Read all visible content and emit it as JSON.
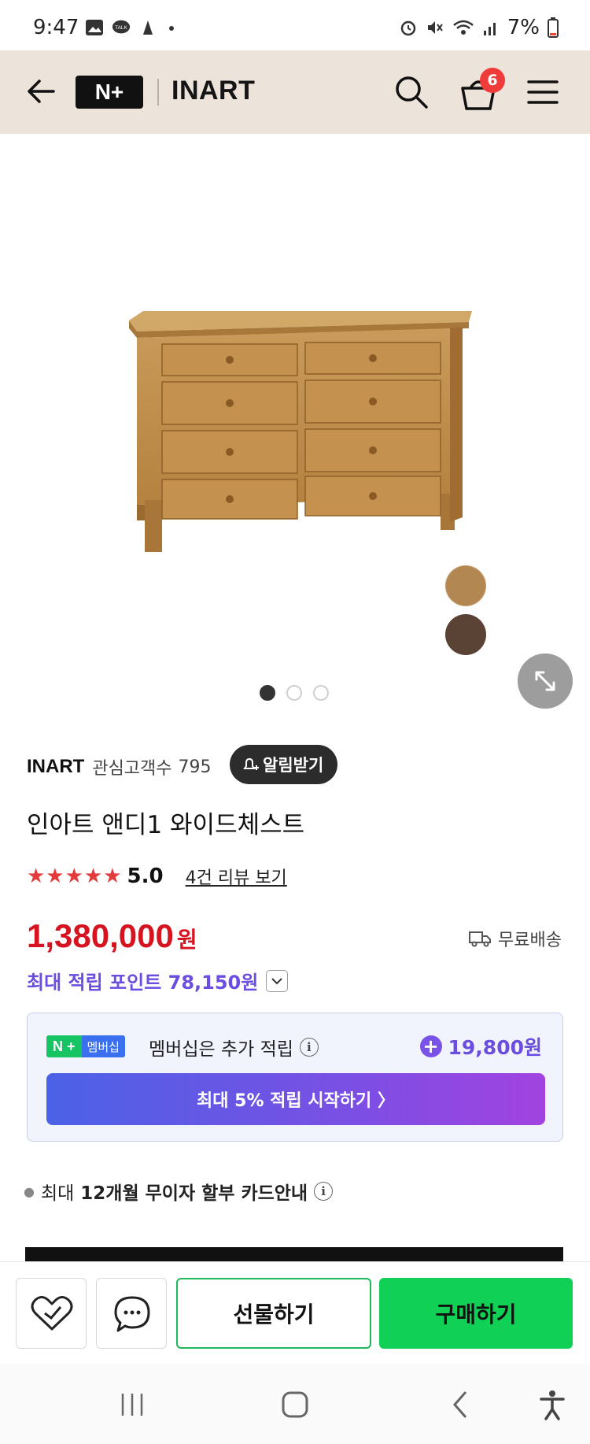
{
  "status_bar": {
    "time": "9:47",
    "battery": "7%"
  },
  "header": {
    "logo_text": "N+",
    "store_name": "INART",
    "cart_count": "6"
  },
  "gallery": {
    "swatches": [
      "#b38752",
      "#5a4235"
    ],
    "dot_count": 3,
    "active_dot": 0
  },
  "seller": {
    "name": "INART",
    "fav_label": "관심고객수",
    "fav_count": "795",
    "alert_label": "알림받기"
  },
  "product": {
    "title": "인아트 앤디1 와이드체스트",
    "stars": "★★★★★",
    "rating": "5.0",
    "review_link": "4건 리뷰 보기",
    "price": "1,380,000",
    "price_unit": "원",
    "shipping": "무료배송",
    "points_text": "최대 적립 포인트 78,150원"
  },
  "membership": {
    "badge_n": "N +",
    "badge_label": "멤버십",
    "text": "멤버십은 추가 적립",
    "points": "19,800원",
    "cta": "최대 5% 적립 시작하기 〉"
  },
  "installment": {
    "prefix": "최대",
    "bold": "12개월 무이자 할부 카드안내"
  },
  "bottom": {
    "gift_label": "선물하기",
    "buy_label": "구매하기"
  },
  "colors": {
    "header_bg": "#ece4da",
    "price": "#d6131f",
    "points": "#6b4de0",
    "buy": "#10d156",
    "gift_border": "#1fb85a"
  }
}
